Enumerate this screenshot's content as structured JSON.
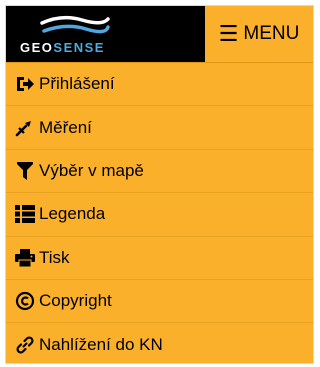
{
  "logo": {
    "text_part1": "GEO",
    "text_part2": "SENSE"
  },
  "header": {
    "menu_label": "MENU",
    "menu_icon": "hamburger-icon"
  },
  "menu": {
    "items": [
      {
        "label": "Přihlášení",
        "icon": "login-icon"
      },
      {
        "label": "Měření",
        "icon": "measure-icon"
      },
      {
        "label": "Výběr v mapě",
        "icon": "filter-icon"
      },
      {
        "label": "Legenda",
        "icon": "list-icon"
      },
      {
        "label": "Tisk",
        "icon": "print-icon"
      },
      {
        "label": "Copyright",
        "icon": "copyright-icon"
      },
      {
        "label": "Nahlížení do KN",
        "icon": "link-icon"
      }
    ]
  },
  "colors": {
    "accent": "#fbb02b",
    "logo_bg": "#000000",
    "logo_accent": "#4fa9de"
  }
}
